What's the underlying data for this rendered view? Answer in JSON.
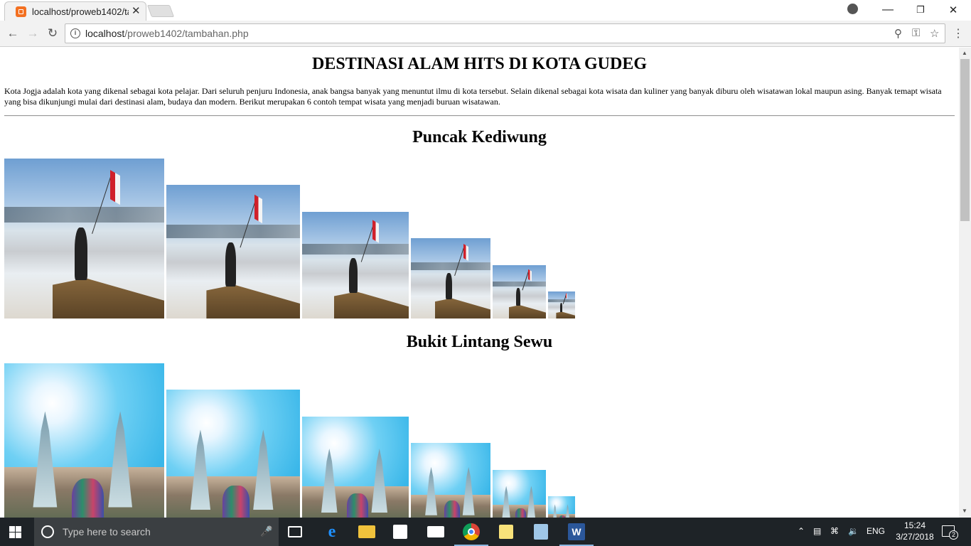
{
  "browser": {
    "tab_title": "localhost/proweb1402/ta",
    "tab_close": "✕",
    "url_host": "localhost",
    "url_path": "/proweb1402/tambahan.php",
    "window_minimize": "—",
    "window_restore": "❐",
    "window_close": "✕"
  },
  "page": {
    "title": "DESTINASI ALAM HITS DI KOTA GUDEG",
    "intro": "Kota Jogja adalah kota yang dikenal sebagai kota pelajar. Dari seluruh penjuru Indonesia, anak bangsa banyak yang menuntut ilmu di kota tersebut. Selain dikenal sebagai kota wisata dan kuliner yang banyak diburu oleh wisatawan lokal maupun asing. Banyak temapt wisata yang bisa dikunjungi mulai dari destinasi alam, budaya dan modern. Berikut merupakan 6 contoh tempat wisata yang menjadi buruan wisatawan.",
    "sections": [
      {
        "heading": "Puncak Kediwung",
        "image_count": 6
      },
      {
        "heading": "Bukit Lintang Sewu",
        "image_count": 6
      }
    ]
  },
  "taskbar": {
    "search_placeholder": "Type here to search",
    "language": "ENG",
    "time": "15:24",
    "date": "3/27/2018",
    "notification_count": "2",
    "apps": [
      "task-view-icon",
      "edge-icon",
      "file-explorer-icon",
      "store-icon",
      "mail-icon",
      "chrome-icon",
      "sticky-notes-icon",
      "app-cube-icon",
      "word-icon"
    ]
  }
}
